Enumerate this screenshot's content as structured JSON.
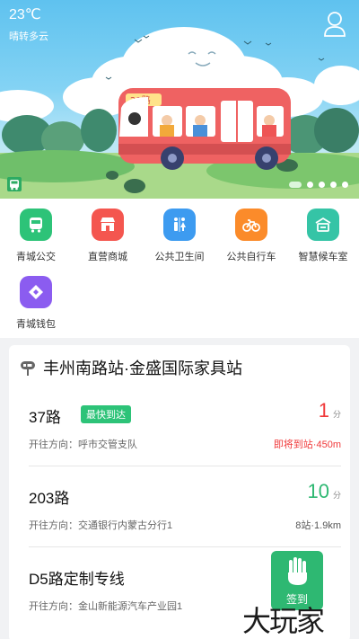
{
  "weather": {
    "temperature": "23℃",
    "condition": "晴转多云"
  },
  "banner": {
    "bus_sign": "21路",
    "carousel_count": 5,
    "carousel_active": 1
  },
  "services": [
    {
      "label": "青城公交",
      "icon": "bus-icon",
      "color": "#2dc378"
    },
    {
      "label": "直营商城",
      "icon": "store-icon",
      "color": "#f4564f"
    },
    {
      "label": "公共卫生间",
      "icon": "restroom-icon",
      "color": "#3d9bf0"
    },
    {
      "label": "公共自行车",
      "icon": "bicycle-icon",
      "color": "#fb8b2a"
    },
    {
      "label": "智慧候车室",
      "icon": "waiting-room-icon",
      "color": "#35c4a6"
    },
    {
      "label": "青城钱包",
      "icon": "wallet-icon",
      "color": "#8b5cf0"
    }
  ],
  "stop": {
    "title": "丰州南路站·金盛国际家具站",
    "routes": [
      {
        "name": "37路",
        "tag": "最快到达",
        "direction": "开往方向：呼市交管支队",
        "eta": "1",
        "eta_unit": "分",
        "eta_color": "#f0393a",
        "distance": "即将到站·450m",
        "distance_color": "#f0393a"
      },
      {
        "name": "203路",
        "tag": "",
        "direction": "开往方向：交通银行内蒙古分行1",
        "eta": "10",
        "eta_unit": "分",
        "eta_color": "#2eb872",
        "distance": "8站·1.9km",
        "distance_color": "#555555"
      },
      {
        "name": "D5路定制专线",
        "tag": "",
        "direction": "开往方向：金山新能源汽车产业园1",
        "eta": "",
        "eta_unit": "",
        "eta_color": "#2eb872",
        "distance": "",
        "distance_color": "#555555"
      }
    ]
  },
  "signin": {
    "label": "签到"
  },
  "watermark": "大玩家"
}
